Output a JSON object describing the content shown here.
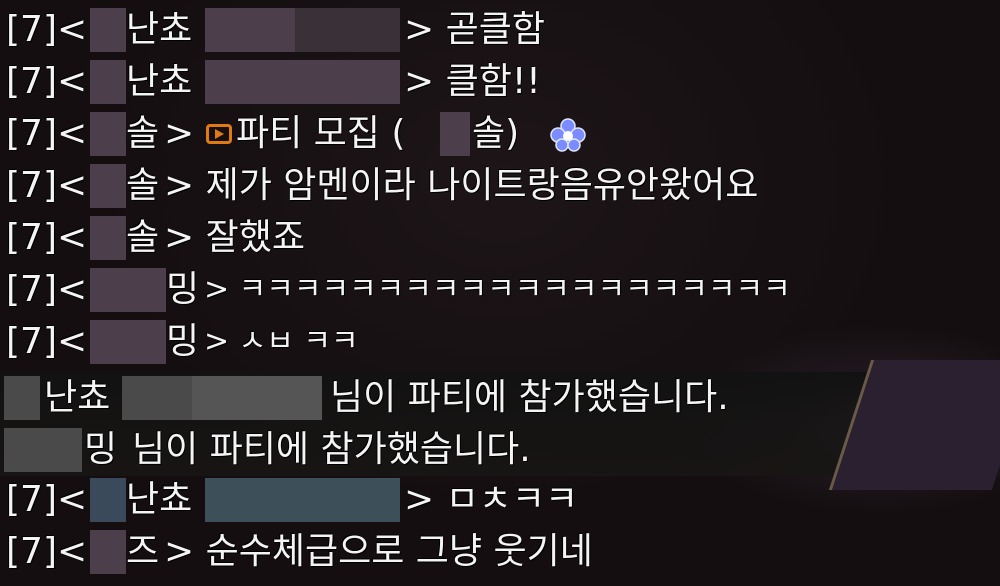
{
  "chat": {
    "channel_prefix": "[7]<",
    "lines": [
      {
        "name": "난쵸",
        "msg": "> 곧클함"
      },
      {
        "name": "난쵸",
        "msg": "> 클함!!"
      },
      {
        "name": "솔",
        "msg_before": ">",
        "msg": "파티 모집 (",
        "msg_mid": "솔)"
      },
      {
        "name": "솔",
        "msg": "> 제가 암멘이라 나이트랑음유안왔어요"
      },
      {
        "name": "솔",
        "msg": "> 잘했죠"
      },
      {
        "name": "밍",
        "msg": "> ㅋㅋㅋㅋㅋㅋㅋㅋㅋㅋㅋㅋㅋㅋㅋㅋㅋㅋㅋㅋ"
      },
      {
        "name": "밍",
        "msg": "> ㅅㅂ ㅋㅋ"
      },
      {
        "name": "난쵸",
        "msg": "님이 파티에 참가했습니다."
      },
      {
        "name": "밍",
        "msg": "님이 파티에 참가했습니다."
      },
      {
        "name": "난쵸",
        "msg": "> ㅁㅊㅋㅋ"
      },
      {
        "name": "즈",
        "msg": "> 순수체급으로 그냥 웃기네"
      }
    ]
  },
  "icons": {
    "party_recruit": "party-recruit-icon",
    "flower": "flower-icon"
  },
  "colors": {
    "text": "#f4f4f4",
    "party_icon": "#e07a12",
    "flower": "#7a8cff"
  }
}
